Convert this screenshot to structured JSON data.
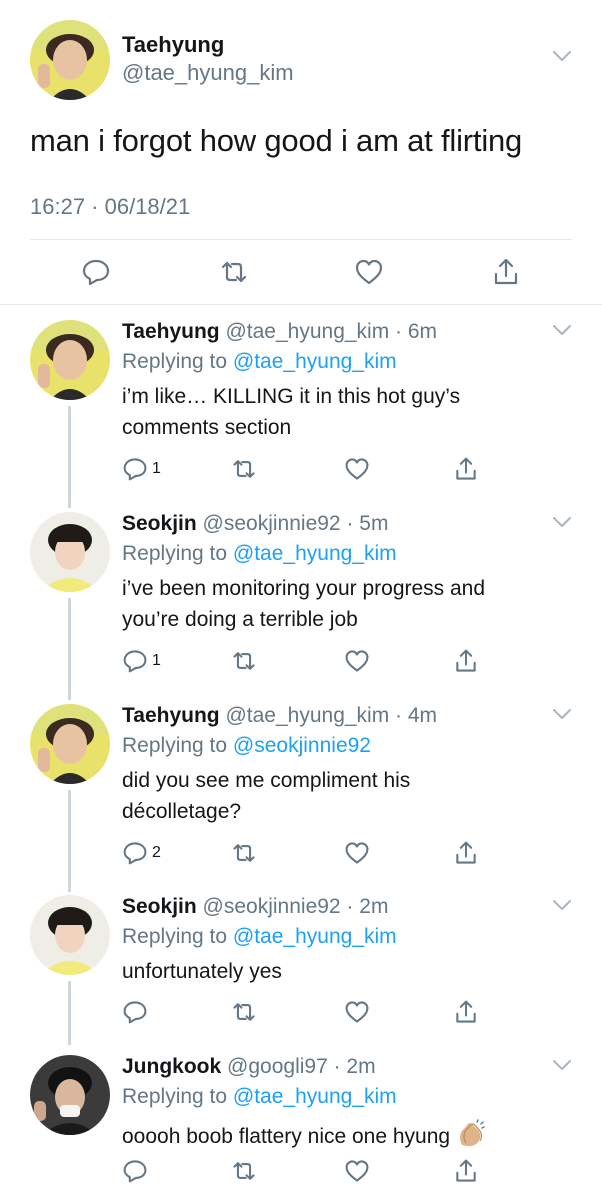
{
  "main_tweet": {
    "author_name": "Taehyung",
    "handle": "@tae_hyung_kim",
    "text": "man i forgot how good i am at flirting",
    "timestamp": "16:27 · 06/18/21"
  },
  "replies": [
    {
      "author_name": "Taehyung",
      "handle_time": "@tae_hyung_kim · 6m",
      "replying_label": "Replying to",
      "replying_to": "@tae_hyung_kim",
      "line1": "i’m like… KILLING it in this hot guy’s",
      "line2": "comments section",
      "reply_count": "1",
      "avatar_icon": "boy-avatar-yellow"
    },
    {
      "author_name": "Seokjin",
      "handle_time": "@seokjinnie92 · 5m",
      "replying_label": "Replying to",
      "replying_to": "@tae_hyung_kim",
      "line1": "i’ve been monitoring your progress and",
      "line2": "you’re doing a terrible job",
      "reply_count": "1",
      "avatar_icon": "boy-avatar-yellow-hood"
    },
    {
      "author_name": "Taehyung",
      "handle_time": "@tae_hyung_kim · 4m",
      "replying_label": "Replying to",
      "replying_to": "@seokjinnie92",
      "line1": "did you see me compliment his",
      "line2": "décolletage?",
      "reply_count": "2",
      "avatar_icon": "boy-avatar-yellow"
    },
    {
      "author_name": "Seokjin",
      "handle_time": "@seokjinnie92 · 2m",
      "replying_label": "Replying to",
      "replying_to": "@tae_hyung_kim",
      "line1": "unfortunately yes",
      "line2": "",
      "reply_count": "",
      "avatar_icon": "boy-avatar-yellow-hood"
    },
    {
      "author_name": "Jungkook",
      "handle_time": "@googli97 · 2m",
      "replying_label": "Replying to",
      "replying_to": "@tae_hyung_kim",
      "line1": "ooooh boob flattery nice one hyung",
      "line2": "",
      "reply_count": "",
      "avatar_icon": "boy-avatar-dark",
      "emoji": "clapping-hands-icon"
    }
  ],
  "colors": {
    "link": "#1da1f2",
    "secondary_text": "#657786",
    "icon": "#657786",
    "divider": "#e1e8ed"
  }
}
